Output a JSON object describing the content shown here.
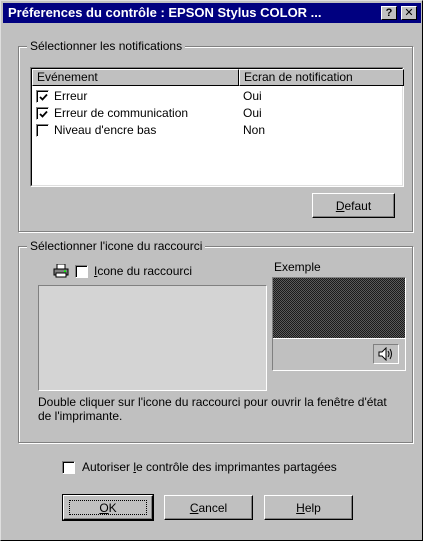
{
  "window": {
    "title": "Préferences du contrôle : EPSON Stylus COLOR ...",
    "help_glyph": "?",
    "close_glyph": "✕"
  },
  "notifications": {
    "group_label": "Sélectionner les notifications",
    "columns": [
      "Evénement",
      "Ecran de notification"
    ],
    "rows": [
      {
        "event": "Erreur",
        "value": "Oui",
        "checked": true
      },
      {
        "event": "Erreur de communication",
        "value": "Oui",
        "checked": true
      },
      {
        "event": "Niveau d'encre bas",
        "value": "Non",
        "checked": false
      }
    ],
    "default_button": {
      "label_hot": "D",
      "label_rest": "efaut"
    }
  },
  "shortcut": {
    "group_label": "Sélectionner l'icone du raccourci",
    "checkbox": {
      "label_hot": "I",
      "label_rest": "cone du raccourci",
      "checked": false
    },
    "example_label": "Exemple",
    "description": "Double cliquer sur l'icone du raccourci pour ouvrir la fenêtre d'état de l'imprimante.",
    "icons": {
      "printer": "printer-icon",
      "speaker": "speaker-icon"
    }
  },
  "shared": {
    "label_before": "Autoriser ",
    "label_hot": "l",
    "label_after": "e contrôle des imprimantes partagées",
    "checked": false
  },
  "buttons": {
    "ok": {
      "label_hot": "O",
      "label_rest": "K"
    },
    "cancel": {
      "label_hot": "C",
      "label_rest": "ancel"
    },
    "help": {
      "label_hot": "H",
      "label_rest": "elp"
    }
  },
  "colors": {
    "titlebar": "#000080",
    "face": "#c0c0c0",
    "preview_dark": "#2a2a2a"
  }
}
